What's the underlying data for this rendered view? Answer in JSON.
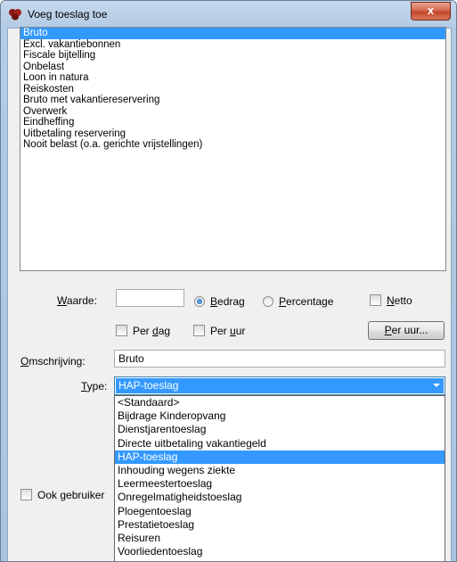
{
  "window": {
    "title": "Voeg toeslag toe",
    "close_label": "x"
  },
  "list": {
    "items": [
      "Bruto",
      "Excl. vakantiebonnen",
      "Fiscale bijtelling",
      "Onbelast",
      "Loon in natura",
      "Reiskosten",
      "Bruto met vakantiereservering",
      "Overwerk",
      "Eindheffing",
      "Uitbetaling reservering",
      "Nooit belast (o.a. gerichte vrijstellingen)"
    ],
    "selected_index": 0
  },
  "waarde": {
    "label_u": "W",
    "label_rest": "aarde:",
    "value": "",
    "bedrag_u": "B",
    "bedrag_rest": "edrag",
    "percentage_u": "P",
    "percentage_rest": "ercentage",
    "netto_u": "N",
    "netto_rest": "etto"
  },
  "per": {
    "dag_pre": "Per ",
    "dag_u": "d",
    "dag_rest": "ag",
    "uur_pre": "Per ",
    "uur_u": "u",
    "uur_rest": "ur",
    "button_u": "P",
    "button_rest": "er uur..."
  },
  "omschrijving": {
    "label_u": "O",
    "label_rest": "mschrijving:",
    "value": "Bruto"
  },
  "type": {
    "label_u": "T",
    "label_rest": "ype:",
    "selected": "HAP-toeslag",
    "options": [
      "<Standaard>",
      "Bijdrage Kinderopvang",
      "Dienstjarentoeslag",
      "Directe uitbetaling vakantiegeld",
      "HAP-toeslag",
      "Inhouding wegens ziekte",
      "Leermeestertoeslag",
      "Onregelmatigheidstoeslag",
      "Ploegentoeslag",
      "Prestatietoeslag",
      "Reisuren",
      "Voorliedentoeslag"
    ],
    "selected_index": 4
  },
  "ook": {
    "pre": "Ook ",
    "u": "g",
    "rest": "ebruiker"
  },
  "colors": {
    "selection": "#3399ff",
    "dialog_bg": "#f0f0f0",
    "close": "#c2462a"
  }
}
